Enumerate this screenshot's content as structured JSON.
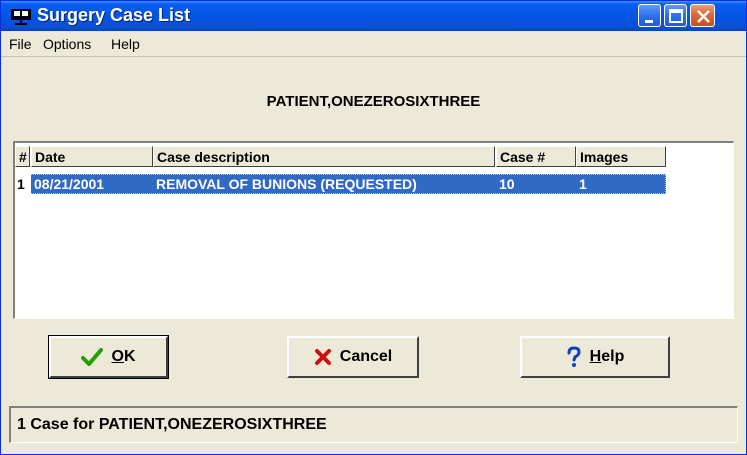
{
  "window": {
    "title": "Surgery Case List",
    "title_color": "#0055e5"
  },
  "menu": {
    "items": [
      {
        "label": "File"
      },
      {
        "label": "Options"
      },
      {
        "label": "Help"
      }
    ]
  },
  "patient": {
    "name": "PATIENT,ONEZEROSIXTHREE"
  },
  "table": {
    "columns": [
      {
        "label": "#"
      },
      {
        "label": "Date"
      },
      {
        "label": "Case description"
      },
      {
        "label": "Case #"
      },
      {
        "label": "Images"
      }
    ],
    "rows": [
      {
        "index": "1",
        "date": "08/21/2001",
        "description": "REMOVAL OF BUNIONS (REQUESTED)",
        "case_number": "10",
        "images": "1",
        "selected": true
      }
    ],
    "selection_color": "#316ac5"
  },
  "buttons": {
    "ok": {
      "underline": "O",
      "rest": "K",
      "icon": "checkmark-icon",
      "icon_color": "#22a000"
    },
    "cancel": {
      "label": "Cancel",
      "icon": "x-icon",
      "icon_color": "#cc1010"
    },
    "help": {
      "underline": "H",
      "rest": "elp",
      "icon": "question-mark-icon",
      "icon_color": "#1040c0"
    }
  },
  "status": {
    "text": "1 Case for PATIENT,ONEZEROSIXTHREE"
  }
}
